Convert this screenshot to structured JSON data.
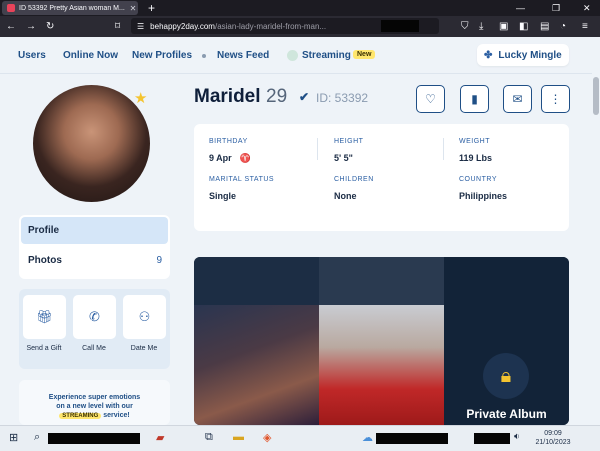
{
  "browser": {
    "tab_title": "ID 53392 Pretty Asian woman M...",
    "url_host": "behappy2day.com",
    "url_path": "/asian-lady-maridel-from-man..."
  },
  "site": {
    "menu": [
      "Users",
      "Online Now",
      "New Profiles",
      "News Feed",
      "Streaming"
    ],
    "new_badge": "New",
    "lucky_mingle": "Lucky Mingle"
  },
  "profile": {
    "name": "Maridel",
    "age": "29",
    "id_label": "ID: 53392",
    "info": [
      {
        "label": "BIRTHDAY",
        "value": "9 Apr",
        "symbol": "♈"
      },
      {
        "label": "HEIGHT",
        "value": "5' 5\""
      },
      {
        "label": "WEIGHT",
        "value": "119 Lbs"
      },
      {
        "label": "MARITAL STATUS",
        "value": "Single"
      },
      {
        "label": "CHILDREN",
        "value": "None"
      },
      {
        "label": "COUNTRY",
        "value": "Philippines"
      }
    ]
  },
  "sidebar": {
    "profile_label": "Profile",
    "photos_label": "Photos",
    "photos_count": "9",
    "actions": [
      "Send a Gift",
      "Call Me",
      "Date Me"
    ]
  },
  "promo": {
    "line1": "Experience super emotions",
    "line2": "on a new level with our",
    "streaming": "STREAMING",
    "line3_suffix": " service!"
  },
  "album": {
    "private_label": "Private Album"
  },
  "taskbar": {
    "time": "09:09",
    "date": "21/10/2023"
  },
  "colors": {
    "accent": "#1f4f86",
    "badge": "#ffe66d",
    "star": "#f4c430"
  }
}
